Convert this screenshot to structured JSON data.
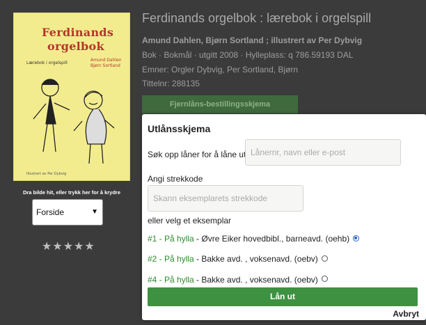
{
  "book": {
    "cover_title_line1": "Ferdinands",
    "cover_title_line2": "orgelbok",
    "cover_subtitle": "Lærebok i orgelspill",
    "cover_author1": "Amund Dahlen",
    "cover_author2": "Bjørn Sortland",
    "cover_illustrator": "Illustrert av Per Dybvig",
    "title": "Ferdinands orgelbok : lærebok i orgelspill",
    "author_line": "Amund Dahlen, Bjørn Sortland ; illustrert av Per Dybvig",
    "meta_line": "Bok · Bokmål · utgitt 2008 · Hylleplass: q 786.59193 DAL",
    "subjects_line": "Emner: Orgler Dybvig, Per Sortland, Bjørn",
    "title_number_line": "Tittelnr: 288135",
    "ill_button": "Fjernlåns-bestillingsskjema"
  },
  "sidebar": {
    "drop_hint": "Dra bilde hit, eller trykk her for å krydre",
    "select_value": "Forside",
    "stars": "★★★★★",
    "rating": 0
  },
  "modal": {
    "title": "Utlånsskjema",
    "borrower_label": "Søk opp låner for å låne ut",
    "borrower_placeholder": "Lånernr, navn eller e-post",
    "barcode_label": "Angi strekkode",
    "barcode_placeholder": "Skann eksemplarets strekkode",
    "or_select_label": "eller velg et eksemplar",
    "copies": [
      {
        "status": "#1 - På hylla",
        "location": " - Øvre Eiker hovedbibl., barneavd. (oehb)",
        "selected": true
      },
      {
        "status": "#2 - På hylla",
        "location": " - Bakke avd. , voksenavd. (oebv)",
        "selected": false
      },
      {
        "status": "#4 - På hylla",
        "location": " - Bakke avd. , voksenavd. (oebv)",
        "selected": false
      }
    ],
    "lend_button": "Lån ut",
    "cancel_link": "Avbryt"
  },
  "colors": {
    "accent_green": "#3d9141",
    "status_green": "#2e8a2e",
    "radio_blue": "#2a62c9"
  }
}
